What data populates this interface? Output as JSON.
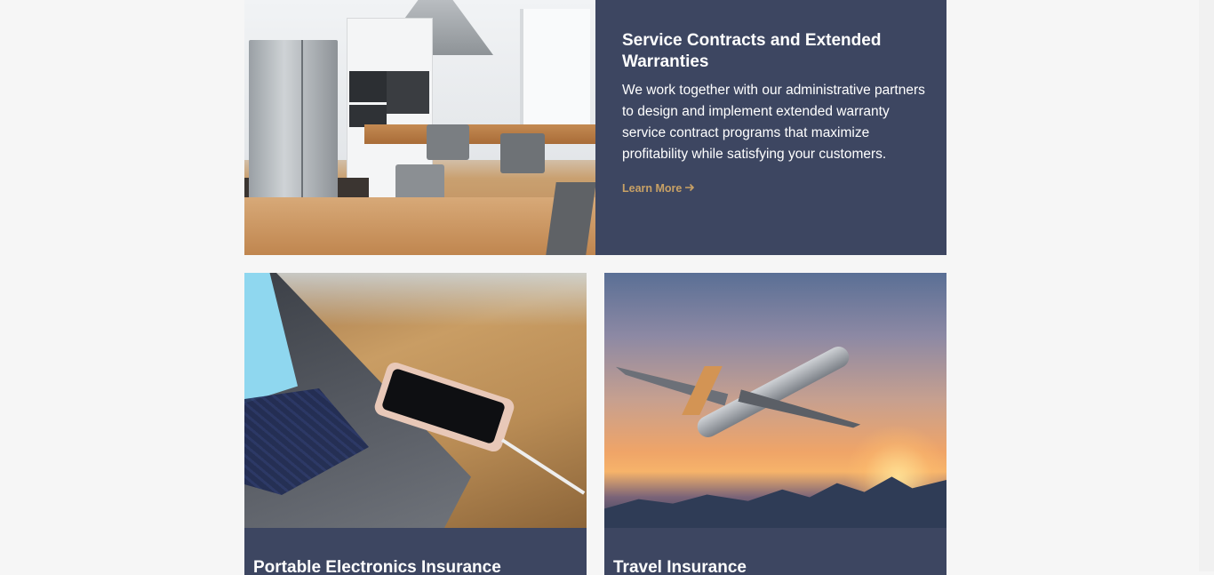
{
  "featured": {
    "title": "Service Contracts and Extended Warranties",
    "description": "We work together with our administrative partners to design and implement extended warranty service contract programs that maximize profitability while satisfying your customers.",
    "cta_label": "Learn More",
    "cta_icon": "arrow-right-icon",
    "image_subject": "kitchen"
  },
  "cards": [
    {
      "title": "Portable Electronics Insurance",
      "image_subject": "laptop-and-phone"
    },
    {
      "title": "Travel Insurance",
      "image_subject": "airplane-at-sunset"
    }
  ],
  "colors": {
    "page_background": "#f6f6f6",
    "card_background": "#3d4661",
    "accent": "#c8a165",
    "text": "#ffffff"
  }
}
